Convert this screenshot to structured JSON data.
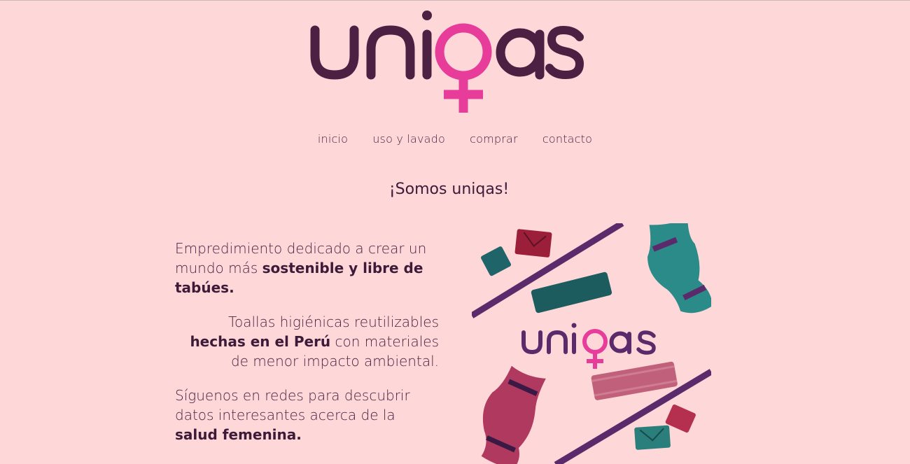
{
  "brand": {
    "logo_text": "uniqas",
    "colors": {
      "primary": "#4b2042",
      "accent": "#e73c9a",
      "background": "#fed7d8"
    }
  },
  "nav": {
    "items": [
      {
        "label": "inicio"
      },
      {
        "label": "uso y lavado"
      },
      {
        "label": "comprar"
      },
      {
        "label": "contacto"
      }
    ]
  },
  "main": {
    "headline": "¡Somos uniqas!",
    "paragraphs": [
      {
        "before": "Empredimiento dedicado a crear un mundo más ",
        "bold": "sostenible y libre de tabúes.",
        "after": ""
      },
      {
        "before": "Toallas higiénicas reutilizables ",
        "bold": "hechas en el Perú",
        "after": " con materiales de menor impacto ambiental."
      },
      {
        "before": "Síguenos en redes para descubrir datos interesantes acerca de la ",
        "bold": "salud femenina.",
        "after": ""
      }
    ],
    "image": {
      "logo_text": "uniqas"
    }
  }
}
